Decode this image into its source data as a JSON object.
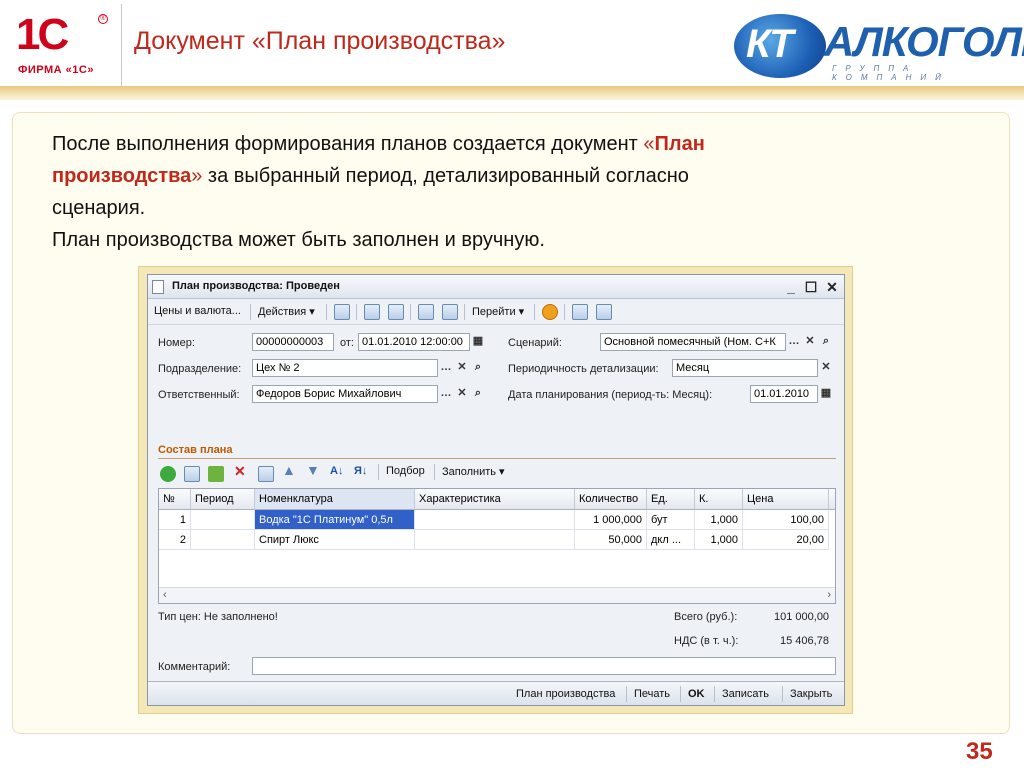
{
  "header": {
    "logo_text": "1С",
    "logo_sub": "ФИРМА «1С»",
    "title": "Документ «План производства»",
    "partner_logo_main": "АЛКОГОЛЬ",
    "partner_logo_kt": "КТ",
    "partner_logo_sub": "ГРУППА КОМПАНИЙ"
  },
  "desc": {
    "line1": "После выполнения формирования планов создается документ ",
    "q1": "«",
    "hl1": "План",
    "hl2": "производства",
    "q2": "»",
    "line2": " за выбранный период, детализированный согласно",
    "line3": "сценария.",
    "line4": "План производства может быть заполнен и вручную."
  },
  "page_number": "35",
  "window": {
    "title": "План производства: Проведен",
    "toolbar": {
      "prices": "Цены и валюта...",
      "actions": "Действия ▾",
      "goto": "Перейти ▾"
    },
    "fields": {
      "number_label": "Номер:",
      "number": "00000000003",
      "from_label": "от:",
      "date": "01.01.2010 12:00:00",
      "dept_label": "Подразделение:",
      "dept": "Цех № 2",
      "resp_label": "Ответственный:",
      "resp": "Федоров Борис Михайлович",
      "scenario_label": "Сценарий:",
      "scenario": "Основной помесячный (Ном. С+К",
      "period_label": "Периодичность детализации:",
      "period": "Месяц",
      "plandate_label": "Дата планирования (период-ть: Месяц):",
      "plandate": "01.01.2010"
    },
    "section": "Состав плана",
    "table_toolbar": {
      "podbor": "Подбор",
      "fill": "Заполнить ▾"
    },
    "columns": [
      "№",
      "Период",
      "Номенклатура",
      "Характеристика",
      "Количество",
      "Ед.",
      "К.",
      "Цена",
      ""
    ],
    "rows": [
      [
        "1",
        "",
        "Водка \"1С Платинум\" 0,5л",
        "",
        "1 000,000",
        "бут",
        "1,000",
        "100,00"
      ],
      [
        "2",
        "",
        "Спирт Люкс",
        "",
        "50,000",
        "дкл ...",
        "1,000",
        "20,00"
      ]
    ],
    "footer": {
      "price_type": "Тип цен: Не заполнено!",
      "total_label": "Всего (руб.):",
      "total": "101 000,00",
      "vat_label": "НДС (в т. ч.):",
      "vat": "15 406,78",
      "comment_label": "Комментарий:"
    },
    "statusbar": {
      "plan": "План производства",
      "print": "Печать",
      "ok": "OK",
      "save": "Записать",
      "close": "Закрыть"
    }
  }
}
